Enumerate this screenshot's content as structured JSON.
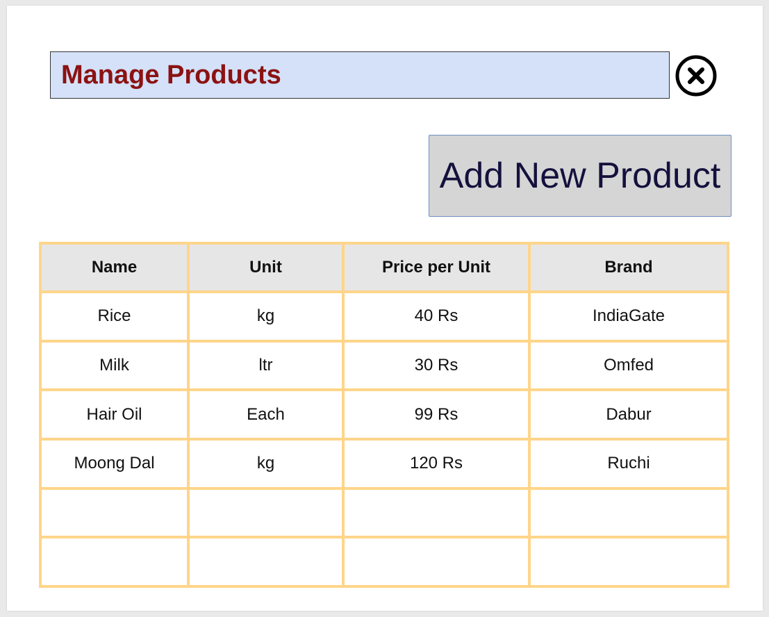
{
  "page": {
    "title": "Manage Products",
    "add_button_label": "Add New Product",
    "close_icon": "close-circle-icon"
  },
  "table": {
    "headers": [
      "Name",
      "Unit",
      "Price per Unit",
      "Brand"
    ],
    "rows": [
      [
        "Rice",
        "kg",
        "40 Rs",
        "IndiaGate"
      ],
      [
        "Milk",
        "ltr",
        "30 Rs",
        "Omfed"
      ],
      [
        "Hair Oil",
        "Each",
        "99 Rs",
        "Dabur"
      ],
      [
        "Moong Dal",
        "kg",
        "120 Rs",
        "Ruchi"
      ],
      [
        "",
        "",
        "",
        ""
      ],
      [
        "",
        "",
        "",
        ""
      ]
    ]
  },
  "colors": {
    "title_background": "#d4e1f8",
    "title_text": "#8b1212",
    "button_background": "#d5d5d5",
    "button_text": "#14113d",
    "table_border": "#ffd58a",
    "header_background": "#e6e6e6"
  }
}
